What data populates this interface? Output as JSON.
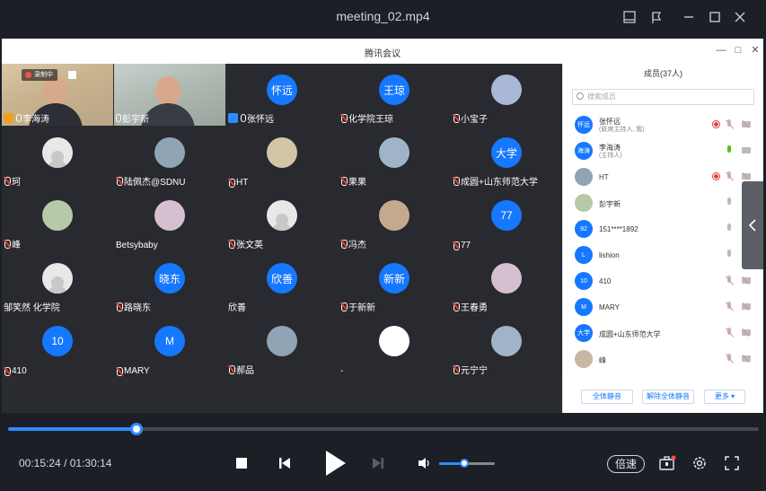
{
  "window": {
    "title": "meeting_02.mp4"
  },
  "meeting": {
    "title": "腾讯会议",
    "recording_badge": "录制中",
    "tiles": [
      {
        "name": "李海涛",
        "avatar": "",
        "kind": "video",
        "mic": "host"
      },
      {
        "name": "彭宇新",
        "avatar": "",
        "kind": "video",
        "mic": "on"
      },
      {
        "name": "张怀远",
        "avatar": "怀远",
        "kind": "blue",
        "mic": "host"
      },
      {
        "name": "化学院王琼",
        "avatar": "王琼",
        "kind": "blue",
        "mic": "muted"
      },
      {
        "name": "小宝子",
        "avatar": "",
        "kind": "photo",
        "mic": "muted"
      },
      {
        "name": "珂",
        "avatar": "",
        "kind": "gray",
        "mic": "muted"
      },
      {
        "name": "陆佩杰@SDNU",
        "avatar": "",
        "kind": "photo",
        "mic": "muted"
      },
      {
        "name": "HT",
        "avatar": "",
        "kind": "photo",
        "mic": "muted"
      },
      {
        "name": "果果",
        "avatar": "",
        "kind": "photo",
        "mic": "muted"
      },
      {
        "name": "成圆+山东师范大学",
        "avatar": "大学",
        "kind": "blue",
        "mic": "muted"
      },
      {
        "name": "峰",
        "avatar": "",
        "kind": "photo",
        "mic": "muted"
      },
      {
        "name": "Betsybaby",
        "avatar": "",
        "kind": "photo",
        "mic": "none"
      },
      {
        "name": "张文英",
        "avatar": "",
        "kind": "gray",
        "mic": "muted"
      },
      {
        "name": "冯杰",
        "avatar": "",
        "kind": "photo",
        "mic": "muted"
      },
      {
        "name": "77",
        "avatar": "77",
        "kind": "blue",
        "mic": "muted"
      },
      {
        "name": "邹笑然 化学院",
        "avatar": "",
        "kind": "gray",
        "mic": "none"
      },
      {
        "name": "路晓东",
        "avatar": "晓东",
        "kind": "blue",
        "mic": "muted"
      },
      {
        "name": "欣善",
        "avatar": "欣善",
        "kind": "blue",
        "mic": "none"
      },
      {
        "name": "于新新",
        "avatar": "新新",
        "kind": "blue",
        "mic": "muted"
      },
      {
        "name": "王春勇",
        "avatar": "",
        "kind": "photo",
        "mic": "muted"
      },
      {
        "name": "410",
        "avatar": "10",
        "kind": "blue",
        "mic": "muted"
      },
      {
        "name": "MARY",
        "avatar": "M",
        "kind": "blue",
        "mic": "muted"
      },
      {
        "name": "郝品",
        "avatar": "",
        "kind": "photo",
        "mic": "muted"
      },
      {
        "name": "-",
        "avatar": "",
        "kind": "white",
        "mic": "none"
      },
      {
        "name": "元宁宁",
        "avatar": "",
        "kind": "photo",
        "mic": "muted"
      }
    ]
  },
  "panel": {
    "header": "成员(37人)",
    "search_placeholder": "搜索成员",
    "members": [
      {
        "avatar": "怀远",
        "name": "张怀远",
        "sub": "(联席主持人, 我)",
        "rec": true,
        "mic": "red",
        "cam": "red"
      },
      {
        "avatar": "海涛",
        "name": "李海涛",
        "sub": "(主持人)",
        "rec": false,
        "mic": "green",
        "cam": "gray"
      },
      {
        "avatar": "",
        "name": "HT",
        "sub": "",
        "rec": true,
        "mic": "red",
        "cam": "red"
      },
      {
        "avatar": "",
        "name": "彭宇新",
        "sub": "",
        "rec": false,
        "mic": "gray",
        "cam": "gray"
      },
      {
        "avatar": "92",
        "name": "151****1892",
        "sub": "",
        "rec": false,
        "mic": "gray",
        "cam": "gray"
      },
      {
        "avatar": "L",
        "name": "lishion",
        "sub": "",
        "rec": false,
        "mic": "gray",
        "cam": "gray"
      },
      {
        "avatar": "10",
        "name": "410",
        "sub": "",
        "rec": false,
        "mic": "red",
        "cam": "red"
      },
      {
        "avatar": "M",
        "name": "MARY",
        "sub": "",
        "rec": false,
        "mic": "red",
        "cam": "red"
      },
      {
        "avatar": "大学",
        "name": "成圆+山东师范大学",
        "sub": "",
        "rec": false,
        "mic": "red",
        "cam": "red"
      },
      {
        "avatar": "",
        "name": "峰",
        "sub": "",
        "rec": false,
        "mic": "red",
        "cam": "red"
      }
    ],
    "btn_mute_all": "全体静音",
    "btn_unmute_all": "解除全体静音",
    "btn_more": "更多 ▾"
  },
  "player": {
    "current_time": "00:15:24",
    "separator": "/",
    "total_time": "01:30:14",
    "progress": 0.171,
    "volume": 0.45,
    "speed_label": "倍速"
  },
  "colors": {
    "accent": "#2f8cff",
    "avatar_blue": "#1677ff",
    "bg": "#1c1f26"
  }
}
